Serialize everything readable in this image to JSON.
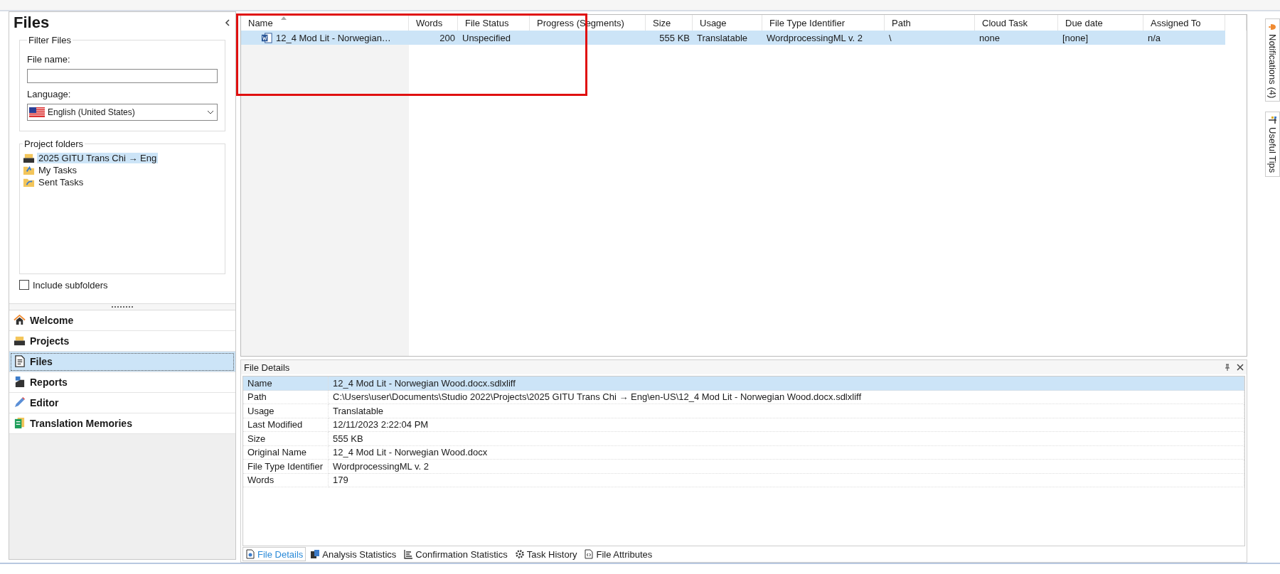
{
  "sidebar": {
    "title": "Files",
    "filter_files": {
      "title": "Filter Files",
      "file_name_label": "File name:",
      "language_label": "Language:",
      "language_value": "English (United States)"
    },
    "project_folders": {
      "title": "Project folders",
      "items": [
        {
          "label": "2025 GITU Trans Chi → Eng",
          "kind": "project",
          "selected": true
        },
        {
          "label": "My Tasks",
          "kind": "my-tasks",
          "selected": false
        },
        {
          "label": "Sent Tasks",
          "kind": "sent-tasks",
          "selected": false
        }
      ]
    },
    "include_subfolders": {
      "label": "Include subfolders",
      "checked": false
    },
    "navigation": [
      {
        "label": "Welcome",
        "kind": "home",
        "selected": false
      },
      {
        "label": "Projects",
        "kind": "projects",
        "selected": false
      },
      {
        "label": "Files",
        "kind": "files",
        "selected": true
      },
      {
        "label": "Reports",
        "kind": "reports",
        "selected": false
      },
      {
        "label": "Editor",
        "kind": "editor",
        "selected": false
      },
      {
        "label": "Translation Memories",
        "kind": "memories",
        "selected": false
      }
    ]
  },
  "files_table": {
    "columns": [
      {
        "label": "Name",
        "sorted": true
      },
      {
        "label": "Words",
        "sorted": false
      },
      {
        "label": "File Status",
        "sorted": false
      },
      {
        "label": "Progress (Segments)",
        "sorted": false
      },
      {
        "label": "Size",
        "sorted": false
      },
      {
        "label": "Usage",
        "sorted": false
      },
      {
        "label": "File Type Identifier",
        "sorted": false
      },
      {
        "label": "Path",
        "sorted": false
      },
      {
        "label": "Cloud Task",
        "sorted": false
      },
      {
        "label": "Due date",
        "sorted": false
      },
      {
        "label": "Assigned To",
        "sorted": false
      }
    ],
    "rows": [
      {
        "selected": true,
        "cells": [
          "12_4 Mod Lit - Norwegian…",
          "200",
          "Unspecified",
          "",
          "555 KB",
          "Translatable",
          "WordprocessingML v. 2",
          "\\",
          "none",
          "[none]",
          "n/a"
        ]
      }
    ]
  },
  "file_details": {
    "title": "File Details",
    "rows": [
      {
        "label": "Name",
        "value": "12_4 Mod Lit - Norwegian Wood.docx.sdlxliff",
        "selected": true
      },
      {
        "label": "Path",
        "value": "C:\\Users\\user\\Documents\\Studio 2022\\Projects\\2025 GITU Trans Chi → Eng\\en-US\\12_4 Mod Lit - Norwegian Wood.docx.sdlxliff",
        "selected": false
      },
      {
        "label": "Usage",
        "value": "Translatable",
        "selected": false
      },
      {
        "label": "Last Modified",
        "value": "12/11/2023 2:22:04 PM",
        "selected": false
      },
      {
        "label": "Size",
        "value": "555 KB",
        "selected": false
      },
      {
        "label": "Original Name",
        "value": "12_4 Mod Lit - Norwegian Wood.docx",
        "selected": false
      },
      {
        "label": "File Type Identifier",
        "value": "WordprocessingML v. 2",
        "selected": false
      },
      {
        "label": "Words",
        "value": "179",
        "selected": false
      }
    ],
    "tabs": [
      {
        "label": "File Details",
        "kind": "details",
        "selected": true
      },
      {
        "label": "Analysis Statistics",
        "kind": "analysis",
        "selected": false
      },
      {
        "label": "Confirmation Statistics",
        "kind": "confirmation",
        "selected": false
      },
      {
        "label": "Task History",
        "kind": "history",
        "selected": false
      },
      {
        "label": "File Attributes",
        "kind": "attributes",
        "selected": false
      }
    ]
  },
  "side_tabs": [
    {
      "label": "Notifications (4)",
      "kind": "bell"
    },
    {
      "label": "Useful Tips",
      "kind": "tips"
    }
  ]
}
